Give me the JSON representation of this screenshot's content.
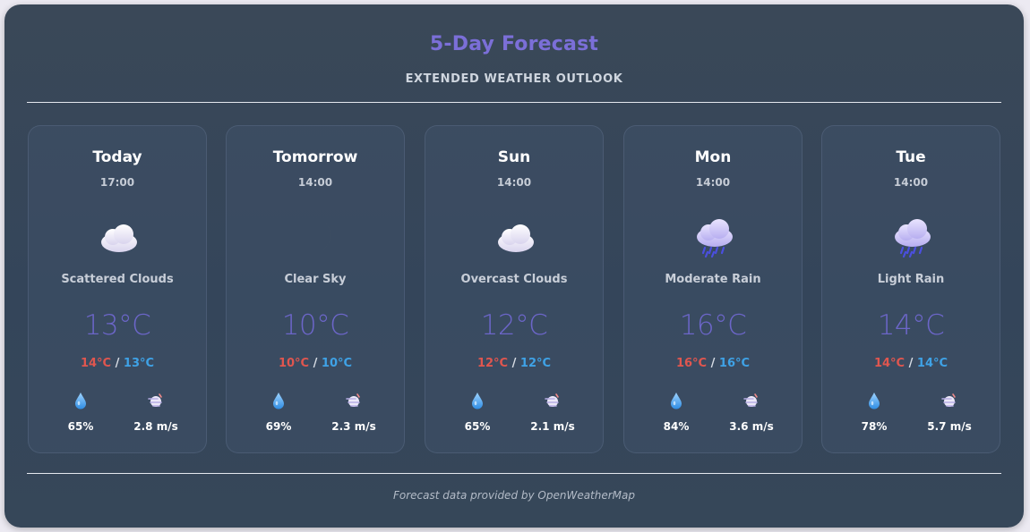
{
  "header": {
    "title": "5-Day Forecast",
    "subtitle": "EXTENDED WEATHER OUTLOOK"
  },
  "colors": {
    "accent": "#7b6fd8",
    "temp": "#6c66c9",
    "high": "#e0564f",
    "low": "#3fa2e6"
  },
  "days": [
    {
      "day": "Today",
      "time": "17:00",
      "icon": "scattered-clouds-icon",
      "desc": "Scattered Clouds",
      "temp": "13°C",
      "high": "14°C",
      "low": "13°C",
      "humidity": "65%",
      "wind": "2.8 m/s"
    },
    {
      "day": "Tomorrow",
      "time": "14:00",
      "icon": "crescent-moon-icon",
      "desc": "Clear Sky",
      "temp": "10°C",
      "high": "10°C",
      "low": "10°C",
      "humidity": "69%",
      "wind": "2.3 m/s"
    },
    {
      "day": "Sun",
      "time": "14:00",
      "icon": "overcast-clouds-icon",
      "desc": "Overcast Clouds",
      "temp": "12°C",
      "high": "12°C",
      "low": "12°C",
      "humidity": "65%",
      "wind": "2.1 m/s"
    },
    {
      "day": "Mon",
      "time": "14:00",
      "icon": "rain-cloud-icon",
      "desc": "Moderate Rain",
      "temp": "16°C",
      "high": "16°C",
      "low": "16°C",
      "humidity": "84%",
      "wind": "3.6 m/s"
    },
    {
      "day": "Tue",
      "time": "14:00",
      "icon": "rain-cloud-icon",
      "desc": "Light Rain",
      "temp": "14°C",
      "high": "14°C",
      "low": "14°C",
      "humidity": "78%",
      "wind": "5.7 m/s"
    }
  ],
  "range_separator": " / ",
  "footer": {
    "text": "Forecast data provided by OpenWeatherMap"
  }
}
